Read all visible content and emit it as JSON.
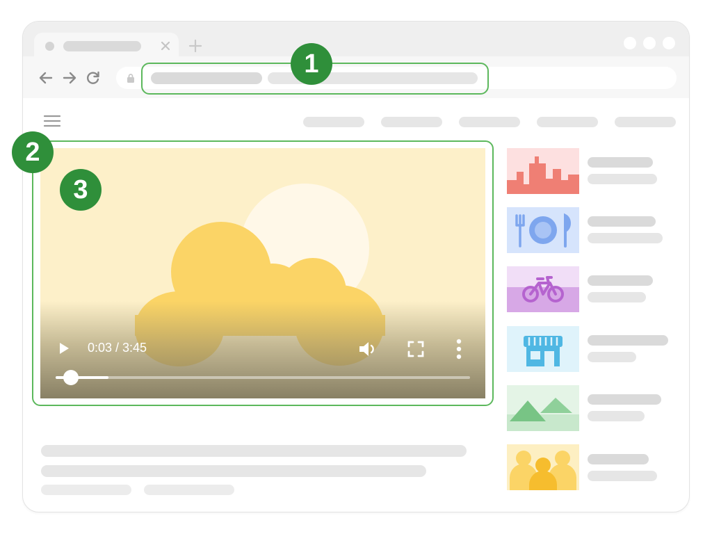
{
  "callouts": [
    "1",
    "2",
    "3"
  ],
  "video": {
    "time_display": "0:03 / 3:45",
    "progress": 0.03
  },
  "colors": {
    "highlight": "#5cb85c",
    "badge": "#2f8f3a",
    "video_background": "#fdf0c9",
    "cloud": "#fbd466",
    "sun": "#fff8e8"
  },
  "sidebar": {
    "thumbnails": [
      {
        "icon": "city-skyline-icon",
        "background": "#fde0e0"
      },
      {
        "icon": "plate-cutlery-icon",
        "background": "#d6e4fc"
      },
      {
        "icon": "bicycle-icon",
        "background": "#f1def7"
      },
      {
        "icon": "storefront-icon",
        "background": "#dff3fb"
      },
      {
        "icon": "mountains-icon",
        "background": "#e4f4e6"
      },
      {
        "icon": "people-group-icon",
        "background": "#fdefc2"
      }
    ]
  }
}
